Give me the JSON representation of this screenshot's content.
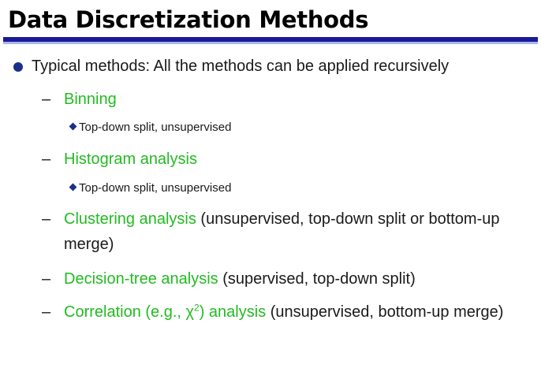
{
  "title": "Data Discretization Methods",
  "main_bullet": "Typical methods: All the methods can be applied recursively",
  "dash": "–",
  "methods": [
    {
      "name": "Binning",
      "detail": "",
      "sub": "Top-down split, unsupervised"
    },
    {
      "name": "Histogram analysis",
      "detail": "",
      "sub": "Top-down split, unsupervised"
    },
    {
      "name": "Clustering analysis",
      "detail": " (unsupervised, top-down split or bottom-up merge)",
      "sub": ""
    },
    {
      "name": "Decision-tree analysis",
      "detail": " (supervised, top-down split)",
      "sub": ""
    },
    {
      "name_prefix": "Correlation (e.g., χ",
      "name_sup": "2",
      "name_suffix": ") analysis",
      "detail": " (unsupervised, bottom-up merge)"
    }
  ],
  "colors": {
    "method_green": "#22bb22",
    "rule_dark": "#1a1a99",
    "rule_light": "#a9b7e6",
    "bullet_blue": "#1a2e8c"
  }
}
